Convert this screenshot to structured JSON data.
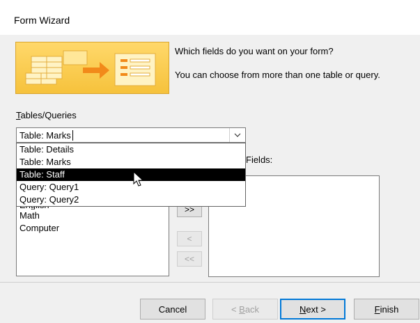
{
  "window": {
    "title": "Form Wizard"
  },
  "intro": {
    "question": "Which fields do you want on your form?",
    "hint": "You can choose from more than one table or query."
  },
  "tables_queries": {
    "label_first": "T",
    "label_rest": "ables/Queries",
    "value": "Table: Marks",
    "options": [
      "Table: Details",
      "Table: Marks",
      "Table: Staff",
      "Query: Query1",
      "Query: Query2"
    ],
    "highlighted": "Table: Staff"
  },
  "available_fields": {
    "items": [
      "English",
      "Math",
      "Computer"
    ]
  },
  "selected_fields": {
    "label": "Fields:",
    "items": []
  },
  "move_buttons": {
    "add_all": ">>",
    "remove_one": "<",
    "remove_all": "<<"
  },
  "footer": {
    "cancel": "Cancel",
    "back_prefix": "< ",
    "back_underlined": "B",
    "back_rest": "ack",
    "next_underlined": "N",
    "next_rest": "ext >",
    "finish_underlined": "F",
    "finish_rest": "inish"
  },
  "icons": {
    "dropdown_arrow": "chevron-down-icon",
    "cursor": "mouse-pointer-icon",
    "wizard_art": "form-wizard-illustration"
  }
}
